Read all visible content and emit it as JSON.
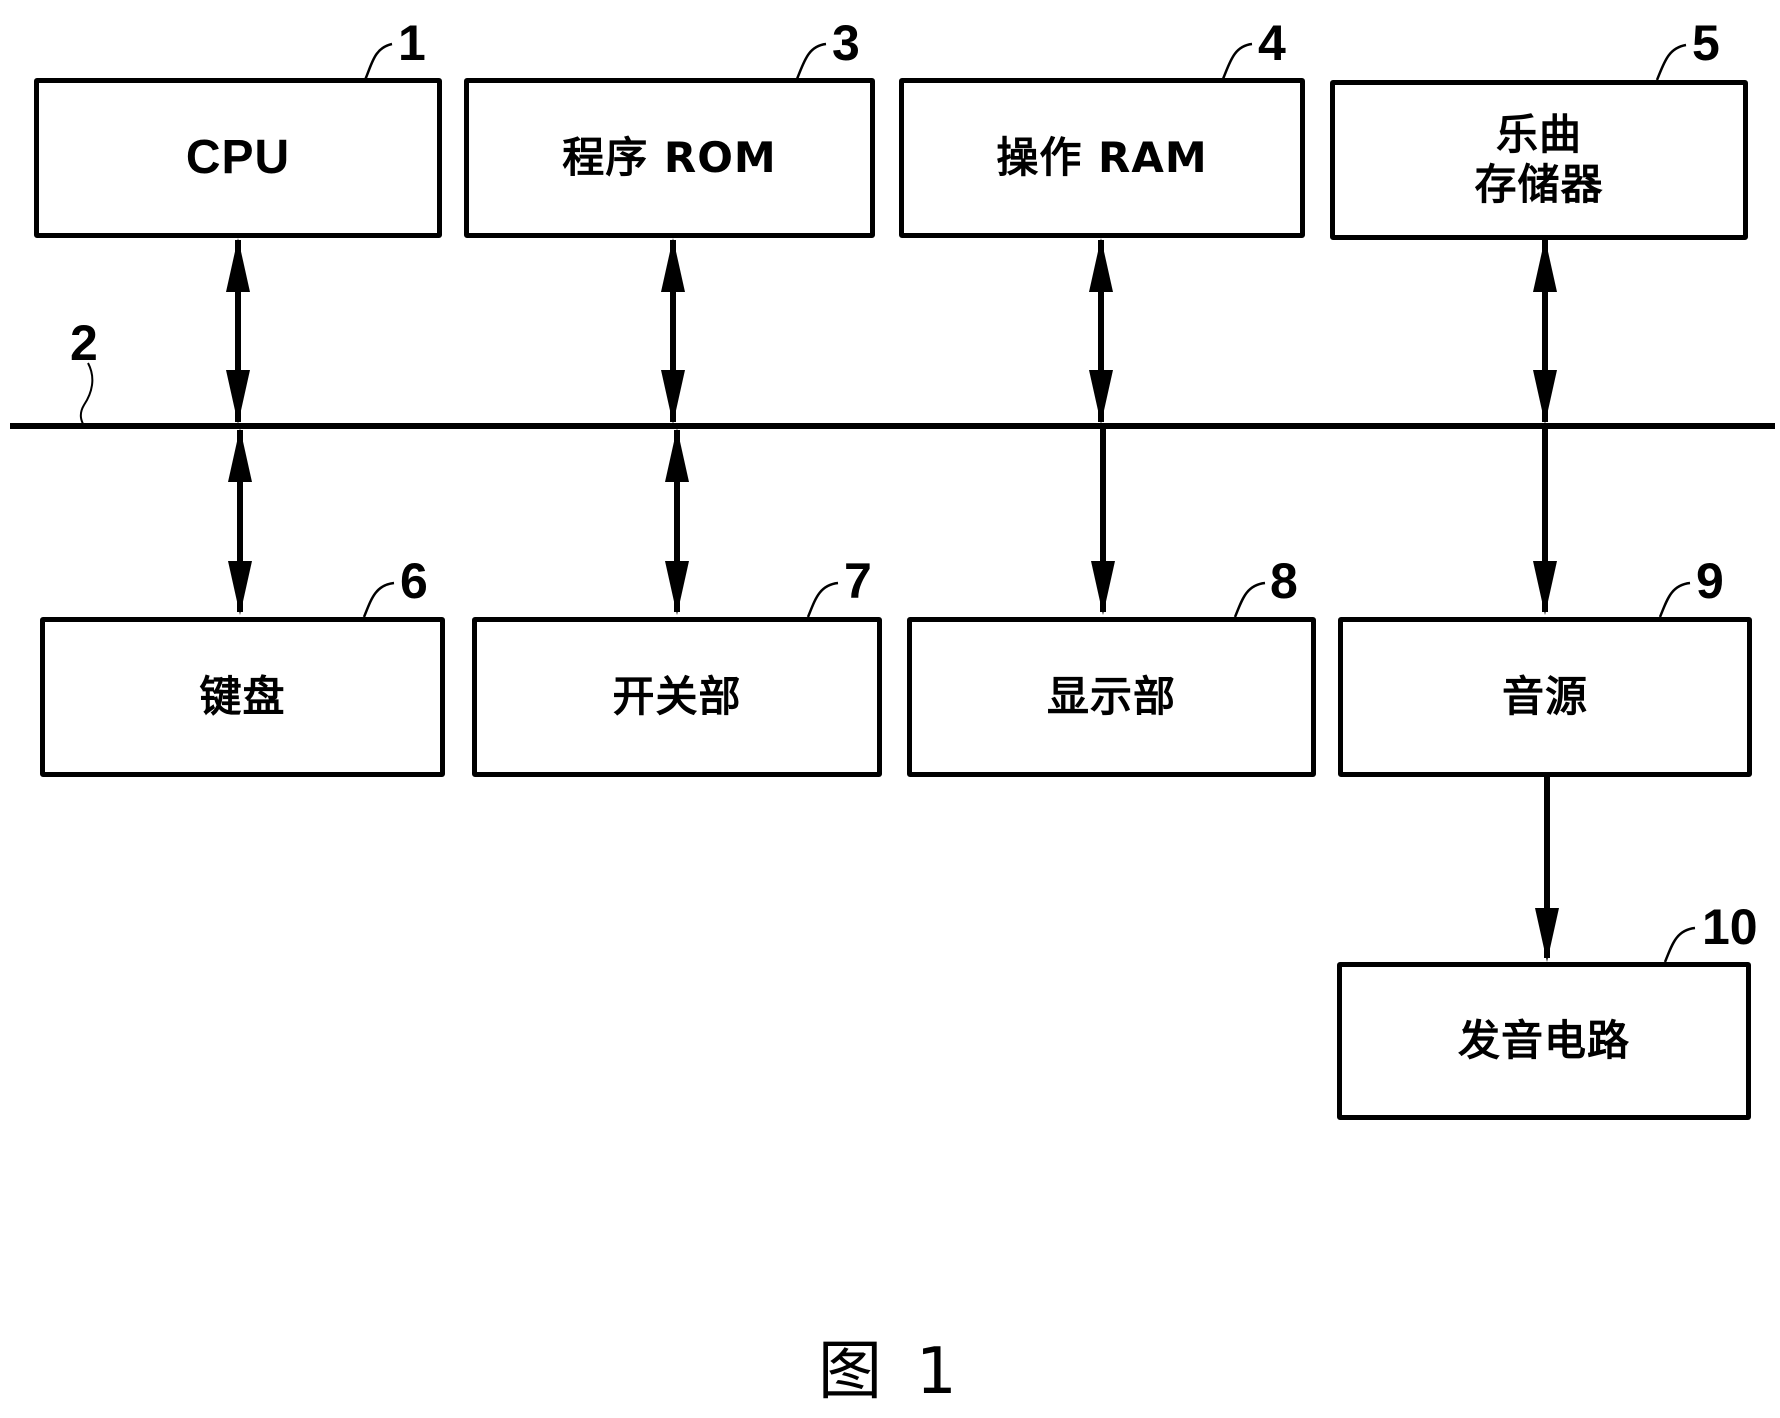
{
  "figure": {
    "caption_prefix": "图",
    "caption_number": "1",
    "bus": {
      "ref": "2",
      "label": "bus"
    },
    "blocks": [
      {
        "id": "cpu",
        "ref": "1",
        "lines": [
          "CPU"
        ],
        "row": "top",
        "link": "bidirectional"
      },
      {
        "id": "rom",
        "ref": "3",
        "lines": [
          "程序 ROM"
        ],
        "row": "top",
        "link": "bidirectional"
      },
      {
        "id": "ram",
        "ref": "4",
        "lines": [
          "操作 RAM"
        ],
        "row": "top",
        "link": "bidirectional"
      },
      {
        "id": "music",
        "ref": "5",
        "lines": [
          "乐曲",
          "存储器"
        ],
        "row": "top",
        "link": "bidirectional"
      },
      {
        "id": "keyboard",
        "ref": "6",
        "lines": [
          "键盘"
        ],
        "row": "bottom",
        "link": "bidirectional"
      },
      {
        "id": "switch",
        "ref": "7",
        "lines": [
          "开关部"
        ],
        "row": "bottom",
        "link": "bidirectional"
      },
      {
        "id": "display",
        "ref": "8",
        "lines": [
          "显示部"
        ],
        "row": "bottom",
        "link": "to-block"
      },
      {
        "id": "tone",
        "ref": "9",
        "lines": [
          "音源"
        ],
        "row": "bottom",
        "link": "to-block"
      },
      {
        "id": "sound",
        "ref": "10",
        "lines": [
          "发音电路"
        ],
        "row": "below-tone",
        "link": "from-tone"
      }
    ]
  }
}
